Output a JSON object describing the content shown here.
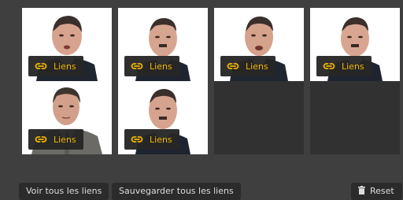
{
  "tiles": [
    {
      "label": "Liens",
      "mustache": false
    },
    {
      "label": "Liens",
      "mustache": true
    },
    {
      "label": "Liens",
      "mustache": false
    },
    {
      "label": "Liens",
      "mustache": true
    },
    {
      "label": "Liens",
      "mustache": false
    },
    {
      "label": "Liens",
      "mustache": true
    }
  ],
  "empty_tiles": 2,
  "footer": {
    "view_all": "Voir tous les liens",
    "save_all": "Sauvegarder tous les liens",
    "reset": "Reset"
  },
  "colors": {
    "accent": "#f0b400",
    "panel": "#3f3f3f",
    "tile_empty": "#313131",
    "button_bg": "#2b2b2b"
  },
  "icons": {
    "link": "link-icon",
    "trash": "trash-icon"
  }
}
